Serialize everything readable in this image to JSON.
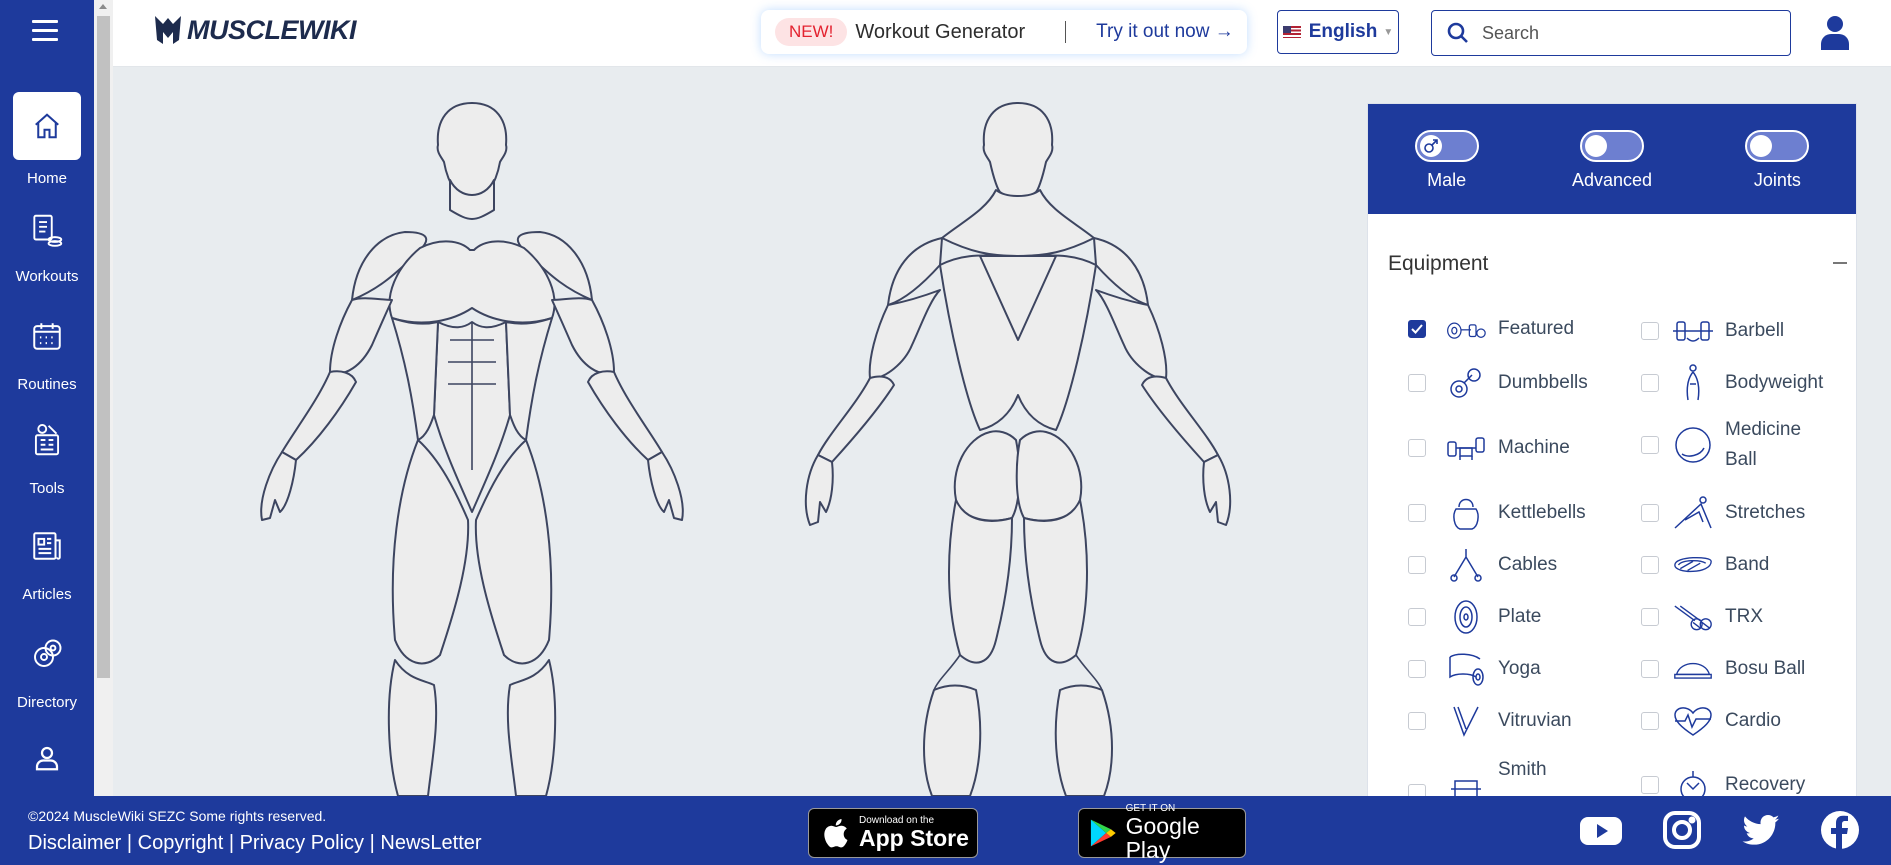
{
  "nav": {
    "items": [
      {
        "label": "Home",
        "icon": "home-icon"
      },
      {
        "label": "Workouts",
        "icon": "workouts-icon"
      },
      {
        "label": "Routines",
        "icon": "calendar-icon"
      },
      {
        "label": "Tools",
        "icon": "tools-icon"
      },
      {
        "label": "Articles",
        "icon": "articles-icon"
      },
      {
        "label": "Directory",
        "icon": "directory-icon"
      }
    ]
  },
  "header": {
    "logo": "MUSCLEWIKI",
    "promo_badge": "NEW!",
    "promo_text": "Workout Generator",
    "promo_link": "Try it out now",
    "language": "English",
    "search_placeholder": "Search"
  },
  "panel": {
    "toggles": [
      {
        "label": "Male",
        "on": false
      },
      {
        "label": "Advanced",
        "on": false
      },
      {
        "label": "Joints",
        "on": false
      }
    ],
    "section_title": "Equipment",
    "equipment": [
      {
        "label": "Featured",
        "checked": true
      },
      {
        "label": "Barbell",
        "checked": false
      },
      {
        "label": "Dumbbells",
        "checked": false
      },
      {
        "label": "Bodyweight",
        "checked": false
      },
      {
        "label": "Machine",
        "checked": false
      },
      {
        "label": "Medicine Ball",
        "checked": false
      },
      {
        "label": "Kettlebells",
        "checked": false
      },
      {
        "label": "Stretches",
        "checked": false
      },
      {
        "label": "Cables",
        "checked": false
      },
      {
        "label": "Band",
        "checked": false
      },
      {
        "label": "Plate",
        "checked": false
      },
      {
        "label": "TRX",
        "checked": false
      },
      {
        "label": "Yoga",
        "checked": false
      },
      {
        "label": "Bosu Ball",
        "checked": false
      },
      {
        "label": "Vitruvian",
        "checked": false
      },
      {
        "label": "Cardio",
        "checked": false
      },
      {
        "label": "Smith",
        "checked": false
      },
      {
        "label": "Recovery",
        "checked": false
      }
    ]
  },
  "footer": {
    "copyright": "©2024 MuscleWiki SEZC Some rights reserved.",
    "links": [
      "Disclaimer",
      "Copyright",
      "Privacy Policy",
      "NewsLetter"
    ],
    "app_store_small": "Download on the",
    "app_store_big": "App Store",
    "google_small": "GET IT ON",
    "google_big": "Google Play"
  },
  "colors": {
    "brand": "#1e3a9c",
    "body_bg": "#e8ecef",
    "alert": "#e3222f"
  }
}
